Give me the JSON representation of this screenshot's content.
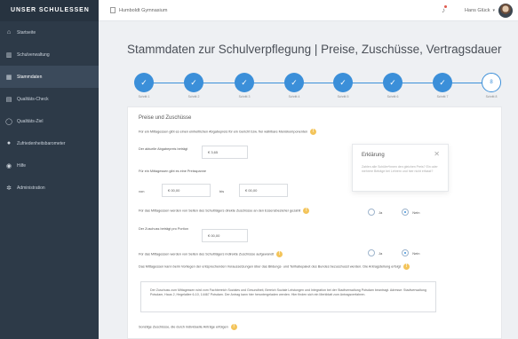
{
  "sidebar": {
    "brand": "UNSER SCHULESSEN",
    "items": [
      {
        "label": "Startseite",
        "icon": "home-icon"
      },
      {
        "label": "Schulverwaltung",
        "icon": "building-icon"
      },
      {
        "label": "Stammdaten",
        "icon": "calendar-icon"
      },
      {
        "label": "Qualitäts-Check",
        "icon": "clipboard-icon"
      },
      {
        "label": "Qualitäts-Ziel",
        "icon": "target-icon"
      },
      {
        "label": "Zufriedenheitsbarometer",
        "icon": "users-icon"
      },
      {
        "label": "Hilfe",
        "icon": "help-icon"
      },
      {
        "label": "Administration",
        "icon": "gear-icon"
      }
    ],
    "active_index": 2
  },
  "topbar": {
    "school": "Humboldt Gymnasium",
    "user": "Hans Glück"
  },
  "page": {
    "title": "Stammdaten zur Schulverpflegung | Preise, Zuschüsse, Vertragsdauer"
  },
  "stepper": {
    "steps": [
      "Schritt 1",
      "Schritt 2",
      "Schritt 3",
      "Schritt 4",
      "Schritt 5",
      "Schritt 6",
      "Schritt 7",
      "Schritt 8"
    ],
    "current": 8,
    "current_label": "8"
  },
  "form": {
    "section_title": "Preise und Zuschüsse",
    "q1": "Für ein Mittagessen gibt es einen einheitlichen Abgabepreis für ein Gericht bzw. frei wählbare Menükomponenten",
    "price_label": "Der aktuelle Abgabepreis beträgt",
    "price_value": "€ 3,65",
    "q2": "Für ein Mittagessen gibt es eine Preisspanne",
    "from_label": "von",
    "from_value": "€ 00,00",
    "to_label": "bis",
    "to_value": "€ 00,00",
    "q3": "Für das Mittagessen werden von Seiten des Schulträgers direkte Zuschüsse an den Essensbezieher gezahlt",
    "q3_options": [
      "Ja",
      "Nein"
    ],
    "q3_selected": "Nein",
    "subsidy_label": "Der Zuschuss beträgt pro Portion",
    "subsidy_value": "€ 00,00",
    "q4": "Für das Mittagessen werden von Seiten des Schulträgers indirekte Zuschüsse aufgewandt",
    "q4_options": [
      "Ja",
      "Nein"
    ],
    "q4_selected": "Nein",
    "q5": "Das Mittagessen kann beim Vorliegen der entsprechenden Voraussetzungen über das Bildungs- und Teilhabepaket des Bundes bezuschusst werden. Die Antragstellung erfolgt",
    "info_text": "Der Zuschuss zum Mittagessen wird vom Fachbereich Soziales und Gesundheit, Bereich Soziale Leistungen und Integration bei der Stadtverwaltung Potsdam beantragt. Adresse: Stadtverwaltung Potsdam, Haus 2, Hegelallee 6-10, 14467 Potsdam. Der Antrag kann hier heruntergeladen werden. Hier finden sich ein Merkblatt zum Antragsverfahren.",
    "q6": "Sonstige Zuschüsse, die durch individuelle Anträge erfolgen"
  },
  "popover": {
    "title": "Erklärung",
    "body": "Zahlen alle Schüler*innen den gleichen Preis? Ein oder mehrere Beträge bei Lehrern und hier nicht erfasst?"
  },
  "colors": {
    "sidebar_bg": "#2d3a48",
    "accent": "#3b8fd9",
    "info": "#f3c45a"
  }
}
